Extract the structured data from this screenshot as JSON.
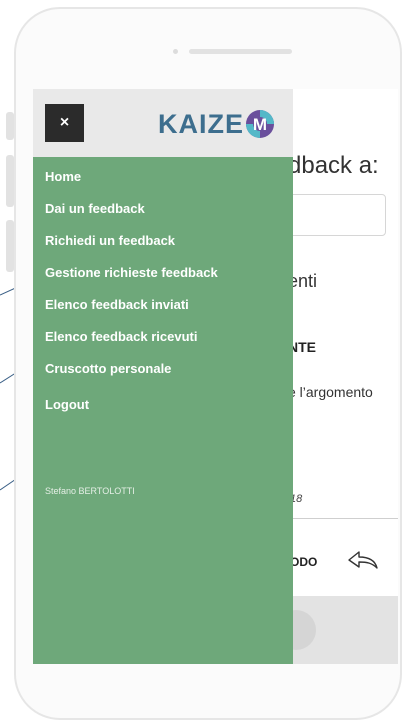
{
  "drawer": {
    "close_label": "×",
    "logo_text": "KAIZE",
    "logo_badge_letter": "M",
    "menu": [
      {
        "label": "Home"
      },
      {
        "label": "Dai un feedback"
      },
      {
        "label": "Richiedi un feedback"
      },
      {
        "label": "Gestione richieste feedback"
      },
      {
        "label": "Elenco feedback inviati"
      },
      {
        "label": "Elenco feedback ricevuti"
      },
      {
        "label": "Cruscotto personale"
      }
    ],
    "logout_label": "Logout",
    "user_name": "Stefano BERTOLOTTI"
  },
  "background_page": {
    "title_fragment": "dback a:",
    "label_fragment_1": "enti",
    "label_fragment_2": "NTE",
    "label_fragment_3": "e l’argomento",
    "date_fragment": "18",
    "reply_fragment": "ODO"
  },
  "colors": {
    "drawer_bg": "#6ea87a",
    "header_bg": "#e9e9e9",
    "close_bg": "#2b2b2b",
    "logo_blue": "#3d6e8e",
    "logo_purple": "#6a4f9c",
    "logo_teal": "#54b8c8"
  }
}
